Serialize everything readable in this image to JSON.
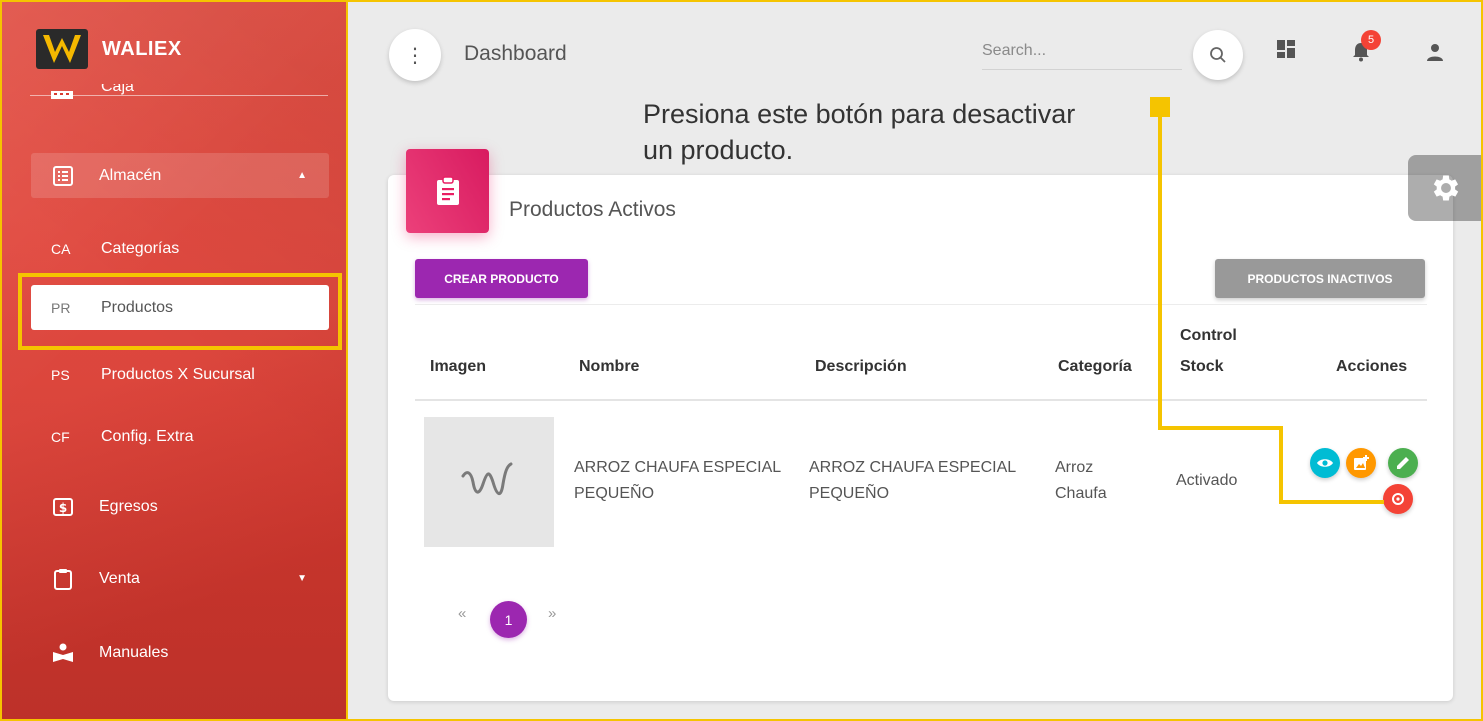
{
  "brand": {
    "name": "WALIEX"
  },
  "sidebar": {
    "caja_label": "Caja",
    "items": [
      {
        "abbr": "",
        "label": "Almacén"
      },
      {
        "abbr": "CA",
        "label": "Categorías"
      },
      {
        "abbr": "PR",
        "label": "Productos"
      },
      {
        "abbr": "PS",
        "label": "Productos X Sucursal"
      },
      {
        "abbr": "CF",
        "label": "Config. Extra"
      },
      {
        "abbr": "",
        "label": "Egresos"
      },
      {
        "abbr": "",
        "label": "Venta"
      },
      {
        "abbr": "",
        "label": "Manuales"
      }
    ]
  },
  "topbar": {
    "title": "Dashboard",
    "search_placeholder": "Search...",
    "notifications_count": "5"
  },
  "callout": {
    "line1": "Presiona este botón para desactivar",
    "line2": "un producto."
  },
  "card": {
    "title": "Productos Activos",
    "create_button": "CREAR PRODUCTO",
    "inactive_button": "PRODUCTOS INACTIVOS"
  },
  "table": {
    "headers": {
      "imagen": "Imagen",
      "nombre": "Nombre",
      "descripcion": "Descripción",
      "categoria": "Categoría",
      "control_line1": "Control",
      "control_line2": "Stock",
      "acciones": "Acciones"
    },
    "rows": [
      {
        "nombre_line1": "ARROZ CHAUFA ESPECIAL",
        "nombre_line2": "PEQUEÑO",
        "descripcion_line1": "ARROZ CHAUFA ESPECIAL",
        "descripcion_line2": "PEQUEÑO",
        "categoria_line1": "Arroz",
        "categoria_line2": "Chaufa",
        "control_stock": "Activado"
      }
    ]
  },
  "pagination": {
    "prev": "«",
    "current": "1",
    "next": "»"
  },
  "colors": {
    "sidebar": "#e8473b",
    "accent_purple": "#9c27b0",
    "card_icon_pink": "#e91e63",
    "callout_yellow": "#f5c400",
    "view_cyan": "#00bcd4",
    "image_orange": "#ff9800",
    "edit_green": "#4caf50",
    "deactivate_red": "#f44336"
  },
  "icons": {
    "menu": "more-vert-icon",
    "search": "search-icon",
    "dashboard": "dashboard-icon",
    "notifications": "bell-icon",
    "user": "person-icon",
    "settings": "gear-icon",
    "card": "clipboard-icon"
  }
}
